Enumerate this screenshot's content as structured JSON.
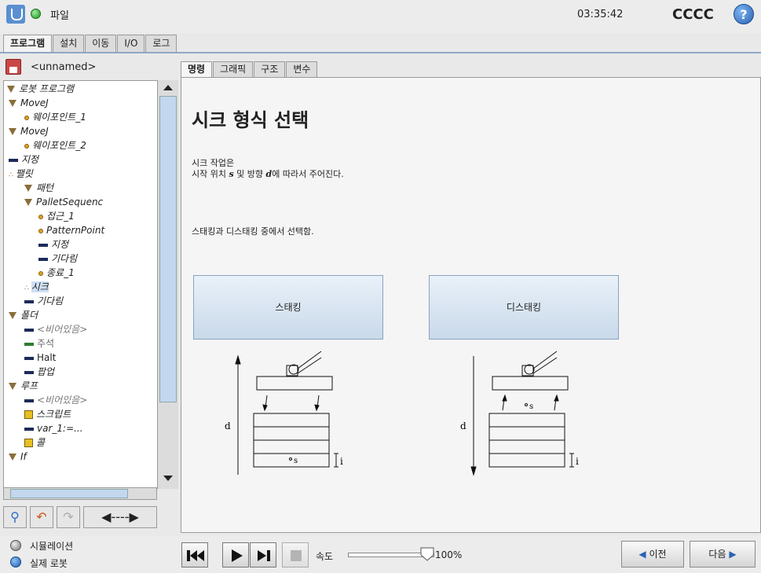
{
  "topbar": {
    "file_label": "파일",
    "clock": "03:35:42",
    "robot_name": "CCCC"
  },
  "main_tabs": [
    {
      "label": "프로그램",
      "active": true
    },
    {
      "label": "설치",
      "active": false
    },
    {
      "label": "이동",
      "active": false
    },
    {
      "label": "I/O",
      "active": false
    },
    {
      "label": "로그",
      "active": false
    }
  ],
  "program": {
    "name": "<unnamed>"
  },
  "tree": [
    {
      "label": "로봇 프로그램",
      "icon": "triangle"
    },
    {
      "label": "MoveJ",
      "icon": "triangle"
    },
    {
      "label": "웨이포인트_1",
      "icon": "waypoint"
    },
    {
      "label": "MoveJ",
      "icon": "triangle"
    },
    {
      "label": "웨이포인트_2",
      "icon": "waypoint"
    },
    {
      "label": "지정",
      "icon": "bar"
    },
    {
      "label": "팰릿",
      "icon": "dots"
    },
    {
      "label": "패턴",
      "icon": "triangle"
    },
    {
      "label": "PalletSequenc",
      "icon": "triangle"
    },
    {
      "label": "접근_1",
      "icon": "waypoint"
    },
    {
      "label": "PatternPoint",
      "icon": "waypoint"
    },
    {
      "label": "지정",
      "icon": "bar"
    },
    {
      "label": "기다림",
      "icon": "bar"
    },
    {
      "label": "종료_1",
      "icon": "waypoint"
    },
    {
      "label": "시크",
      "icon": "dots"
    },
    {
      "label": "기다림",
      "icon": "bar"
    },
    {
      "label": "폴더",
      "icon": "triangle"
    },
    {
      "label": "<비어있음>",
      "icon": "bar"
    },
    {
      "label": "주석",
      "icon": "bar-green"
    },
    {
      "label": "Halt",
      "icon": "bar"
    },
    {
      "label": "팝업",
      "icon": "bar"
    },
    {
      "label": "루프",
      "icon": "triangle"
    },
    {
      "label": "<비어있음>",
      "icon": "bar"
    },
    {
      "label": "스크립트",
      "icon": "script"
    },
    {
      "label": "var_1:=...",
      "icon": "bar"
    },
    {
      "label": "콜",
      "icon": "call"
    },
    {
      "label": "If",
      "icon": "triangle"
    }
  ],
  "panel_tabs": [
    {
      "label": "명령",
      "active": true
    },
    {
      "label": "그래픽",
      "active": false
    },
    {
      "label": "구조",
      "active": false
    },
    {
      "label": "변수",
      "active": false
    }
  ],
  "content": {
    "title": "시크 형식 선택",
    "desc_line1": "시크 작업은",
    "desc_line2_a": "시작 위치 ",
    "desc_s": "s",
    "desc_line2_b": " 및 방향 ",
    "desc_d": "d",
    "desc_line2_c": "에 따라서 주어진다.",
    "choose_text": "스태킹과 디스태킹 중에서 선택함.",
    "stacking_label": "스태킹",
    "destacking_label": "디스태킹",
    "diagram": {
      "d": "d",
      "s": "s",
      "i": "i"
    }
  },
  "bottombar": {
    "sim_label": "시뮬레이션",
    "real_label": "실제 로봇",
    "speed_label": "속도",
    "speed_value": "100%",
    "speed_fraction": 1.0,
    "prev_label": "이전",
    "next_label": "다음"
  }
}
